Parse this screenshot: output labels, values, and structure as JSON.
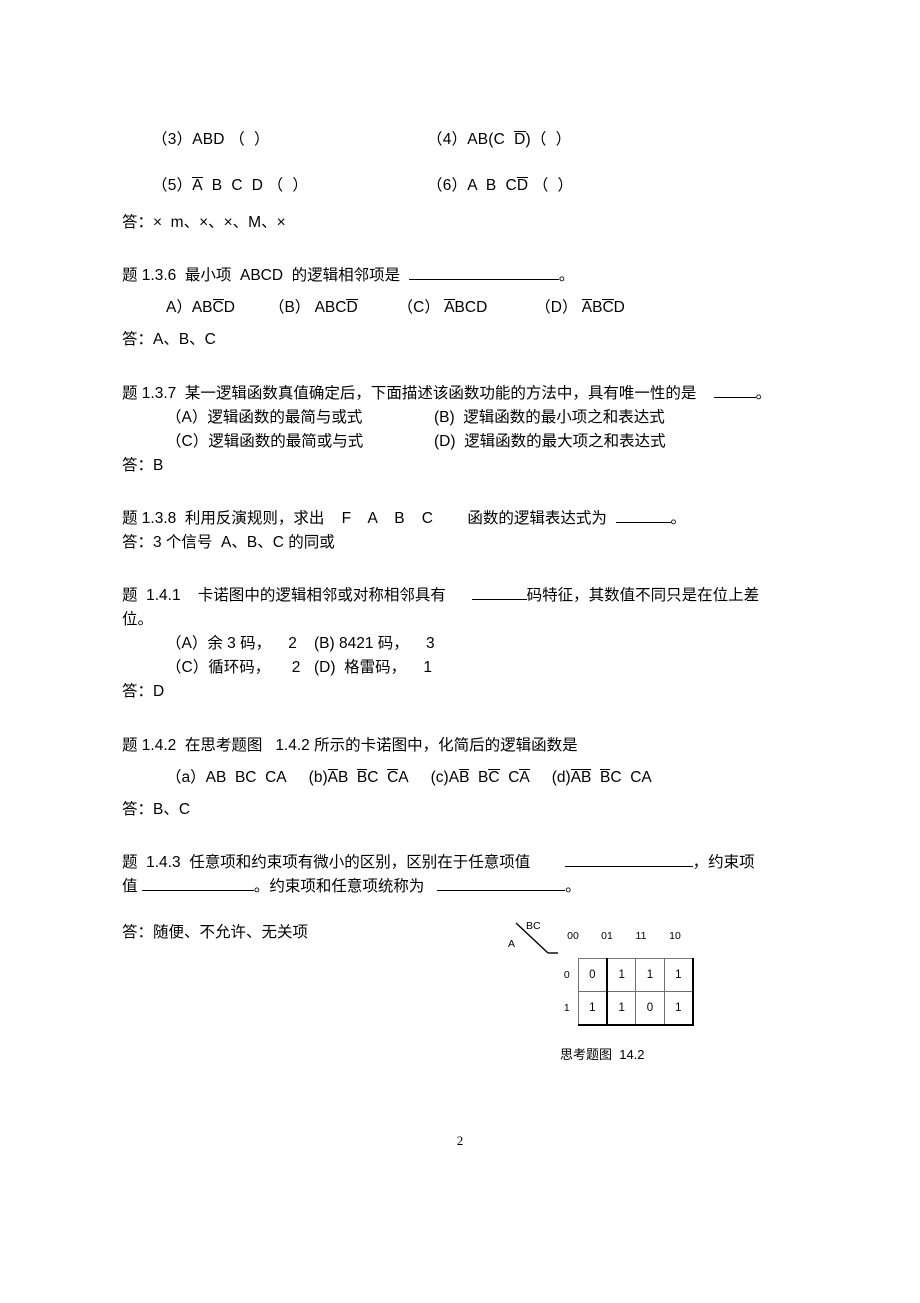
{
  "page": {
    "number": "2",
    "figure_caption": "思考题图  14.2"
  },
  "items_34": {
    "left": {
      "num": "（3）",
      "expr": "ABD",
      "mark": "（  ）"
    },
    "right": {
      "num": "（4）",
      "expr_pre": "AB(C",
      "expr_bar": "D",
      "expr_post": ")",
      "mark": "（  ）"
    }
  },
  "items_56": {
    "left": {
      "num": "（5）",
      "bar": "A",
      "rest": "  B  C  D",
      "mark": "（  ）"
    },
    "right": {
      "num": "（6）",
      "pre": "A  B  C",
      "bar": "D",
      "mark": "（  ）"
    }
  },
  "answer_135": "答：×  m、×、×、M、×",
  "q136": {
    "stem_pre": "题 1.3.6  最小项  ABCD  的逻辑相邻项是",
    "stem_post": "。",
    "options": [
      {
        "label": "A）",
        "p1": "AB",
        "bar": "C",
        "p2": "D"
      },
      {
        "label": "（B）",
        "p1": "ABC",
        "bar": "D",
        "p2": ""
      },
      {
        "label": "（C）",
        "p1": "",
        "bar": "A",
        "p2": "BCD"
      },
      {
        "label": "（D）",
        "p1": "",
        "bar1": "A",
        "mid": "B",
        "bar2": "C",
        "p2": "D"
      }
    ],
    "answer": "答：A、B、C"
  },
  "q137": {
    "stem_pre": "题 1.3.7  某一逻辑函数真值确定后，下面描述该函数功能的方法中，具有唯一性的是",
    "stem_post": "。",
    "optA": "（A）逻辑函数的最简与或式",
    "optB": "(B)  逻辑函数的最小项之和表达式",
    "optC": "（C）逻辑函数的最简或与式",
    "optD": "(D)  逻辑函数的最大项之和表达式",
    "answer": "答：B"
  },
  "q138": {
    "stem_pre": "题 1.3.8  利用反演规则，求出",
    "expr": "F    A    B    C",
    "stem_mid": "函数的逻辑表达式为",
    "stem_post": "。",
    "answer": "答：3 个信号  A、B、C 的同或"
  },
  "q141": {
    "stem_pre": "题  1.4.1    卡诺图中的逻辑相邻或对称相邻具有",
    "stem_post": "码特征，其数值不同只是在位上差",
    "stem_line2": "位。",
    "optA": "（A）余 3 码，    2",
    "optB": "(B) 8421 码，    3",
    "optC": "（C）循环码，     2",
    "optD": "(D)  格雷码，    1",
    "answer": "答：D"
  },
  "q142": {
    "stem": "题 1.4.2  在思考题图   1.4.2 所示的卡诺图中，化简后的逻辑函数是",
    "options": [
      {
        "label": "（a）",
        "terms": [
          {
            "bar": "",
            "plain": "AB"
          },
          {
            "bar": "",
            "plain": "BC"
          },
          {
            "bar": "",
            "plain": "CA"
          }
        ]
      },
      {
        "label": "(b)",
        "terms": [
          {
            "bar": "A",
            "plain": "B"
          },
          {
            "bar": "B",
            "plain": "C"
          },
          {
            "bar": "C",
            "plain": "A"
          }
        ]
      },
      {
        "label": "(c)",
        "terms": [
          {
            "pre": "A",
            "bar": "B",
            "plain": ""
          },
          {
            "pre": "B",
            "bar": "C",
            "plain": ""
          },
          {
            "pre": "C",
            "bar": "A",
            "plain": ""
          }
        ]
      },
      {
        "label": "(d)",
        "terms": [
          {
            "bar": "AB",
            "plain": ""
          },
          {
            "bar": "B",
            "plain": "C"
          },
          {
            "bar": "",
            "plain": "CA"
          }
        ]
      }
    ],
    "answer": "答：B、C"
  },
  "q143": {
    "stem_pre": "题  1.4.3  任意项和约束项有微小的区别，区别在于任意项值",
    "stem_mid": "，约束项",
    "line2_pre": "值",
    "line2_mid": "。约束项和任意项统称为",
    "line2_post": "。",
    "answer": "答：随便、不允许、无关项"
  },
  "kmap": {
    "corner_top_label": "BC",
    "corner_left_label": "A",
    "columns": [
      "00",
      "01",
      "11",
      "10"
    ],
    "rows": [
      {
        "label": "0",
        "cells": [
          "0",
          "1",
          "1",
          "1"
        ]
      },
      {
        "label": "1",
        "cells": [
          "1",
          "1",
          "0",
          "1"
        ]
      }
    ]
  }
}
